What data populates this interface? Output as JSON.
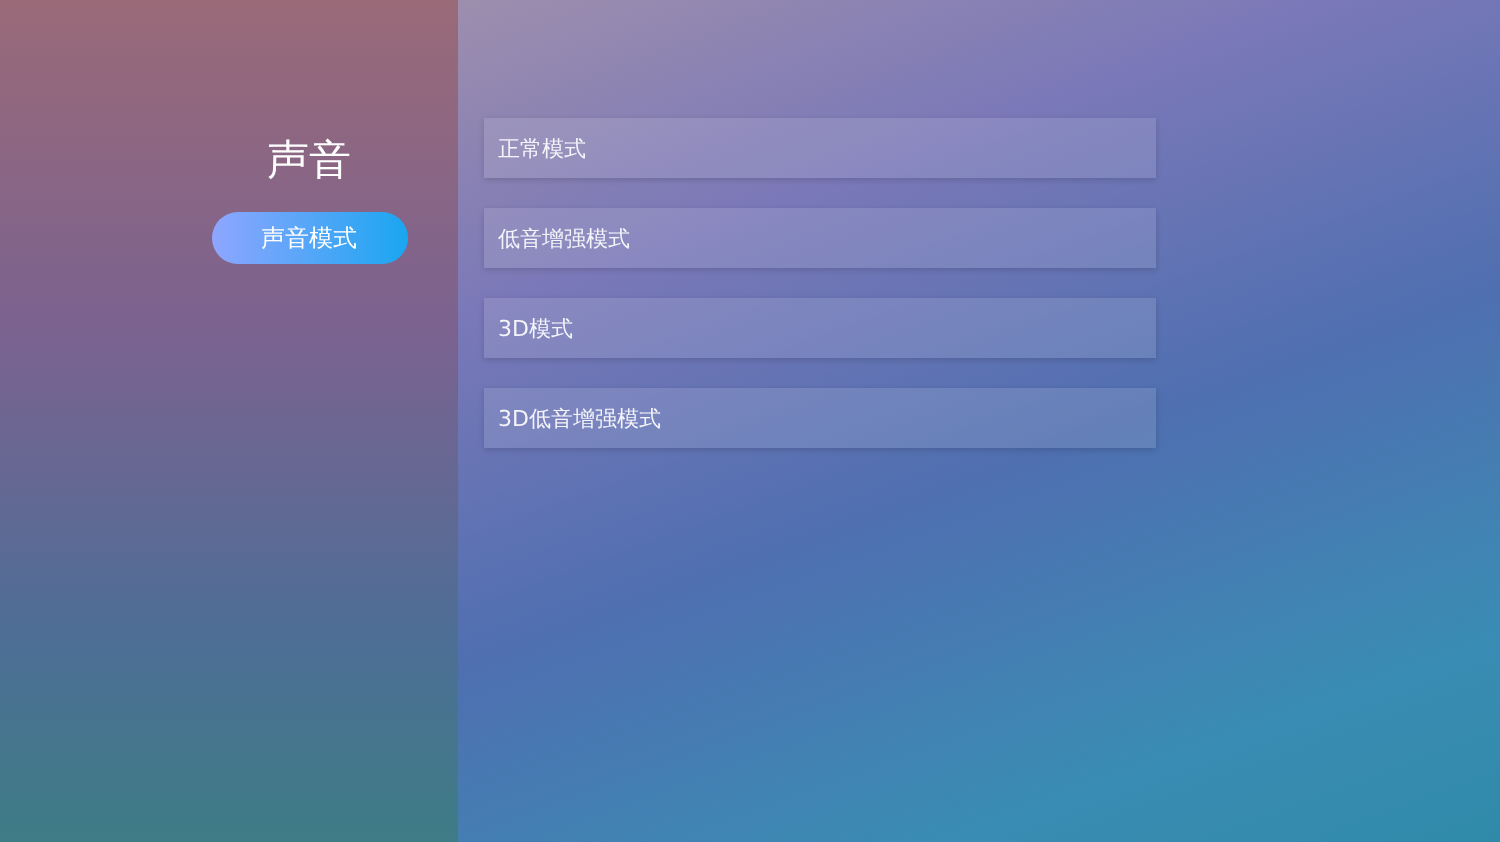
{
  "sidebar": {
    "title": "声音",
    "items": [
      {
        "label": "声音模式",
        "selected": true
      }
    ]
  },
  "options": [
    {
      "label": "正常模式"
    },
    {
      "label": "低音增强模式"
    },
    {
      "label": "3D模式"
    },
    {
      "label": "3D低音增强模式"
    }
  ]
}
